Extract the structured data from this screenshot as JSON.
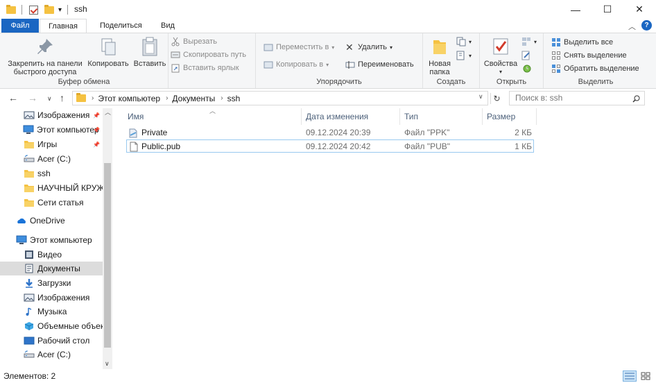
{
  "window": {
    "title": "ssh",
    "minimize_glyph": "—",
    "maximize_glyph": "☐",
    "close_glyph": "✕"
  },
  "ribbon_tabs": {
    "file": "Файл",
    "home": "Главная",
    "share": "Поделиться",
    "view": "Вид"
  },
  "ribbon": {
    "clipboard": {
      "pin_label": "Закрепить на панели быстрого доступа",
      "copy_label": "Копировать",
      "paste_label": "Вставить",
      "cut_label": "Вырезать",
      "copy_path_label": "Скопировать путь",
      "paste_shortcut_label": "Вставить ярлык",
      "group_label": "Буфер обмена"
    },
    "organize": {
      "move_to_label": "Переместить в",
      "copy_to_label": "Копировать в",
      "delete_label": "Удалить",
      "rename_label": "Переименовать",
      "group_label": "Упорядочить"
    },
    "new": {
      "new_folder_label": "Новая папка",
      "group_label": "Создать"
    },
    "open": {
      "properties_label": "Свойства",
      "group_label": "Открыть"
    },
    "select": {
      "select_all_label": "Выделить все",
      "select_none_label": "Снять выделение",
      "invert_label": "Обратить выделение",
      "group_label": "Выделить"
    }
  },
  "address": {
    "crumbs": [
      "Этот компьютер",
      "Документы",
      "ssh"
    ],
    "search_placeholder": "Поиск в: ssh"
  },
  "nav": {
    "items": [
      {
        "label": "Изображения",
        "icon": "pictures-icon",
        "pinned": true
      },
      {
        "label": "Этот компьютер",
        "icon": "computer-icon",
        "pinned": true
      },
      {
        "label": "Игры",
        "icon": "folder-icon",
        "pinned": true
      },
      {
        "label": "Acer (C:)",
        "icon": "drive-icon",
        "pinned": false
      },
      {
        "label": "ssh",
        "icon": "folder-icon",
        "pinned": false
      },
      {
        "label": "НАУЧНЫЙ КРУЖ",
        "icon": "folder-icon",
        "pinned": false
      },
      {
        "label": "Сети статья",
        "icon": "folder-icon",
        "pinned": false
      },
      {
        "label": "OneDrive",
        "icon": "onedrive-icon",
        "pinned": false
      },
      {
        "label": "Этот компьютер",
        "icon": "computer-icon",
        "pinned": false
      },
      {
        "label": "Видео",
        "icon": "video-icon",
        "pinned": false
      },
      {
        "label": "Документы",
        "icon": "documents-icon",
        "pinned": false
      },
      {
        "label": "Загрузки",
        "icon": "downloads-icon",
        "pinned": false
      },
      {
        "label": "Изображения",
        "icon": "pictures-icon",
        "pinned": false
      },
      {
        "label": "Музыка",
        "icon": "music-icon",
        "pinned": false
      },
      {
        "label": "Объемные объек",
        "icon": "3d-objects-icon",
        "pinned": false
      },
      {
        "label": "Рабочий стол",
        "icon": "desktop-icon",
        "pinned": false
      },
      {
        "label": "Acer (C:)",
        "icon": "drive-icon",
        "pinned": false
      }
    ],
    "selected": "Документы"
  },
  "columns": {
    "name": "Имя",
    "date": "Дата изменения",
    "type": "Тип",
    "size": "Размер"
  },
  "files": [
    {
      "name": "Private",
      "date": "09.12.2024 20:39",
      "type": "Файл \"PPK\"",
      "size": "2 КБ",
      "icon": "ppk-file-icon"
    },
    {
      "name": "Public.pub",
      "date": "09.12.2024 20:42",
      "type": "Файл \"PUB\"",
      "size": "1 КБ",
      "icon": "blank-file-icon"
    }
  ],
  "status": {
    "items_count": "Элементов: 2"
  },
  "colors": {
    "accent": "#1a66c2",
    "folder": "#f5c242"
  }
}
